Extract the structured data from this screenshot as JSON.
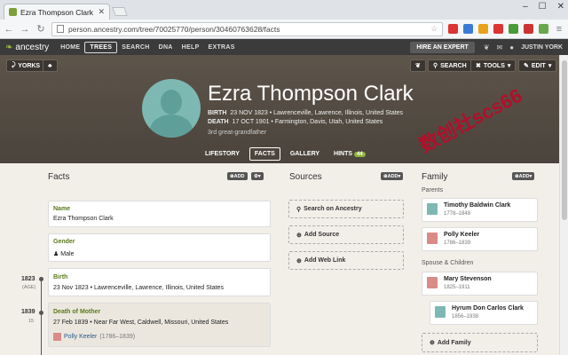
{
  "browser": {
    "tab_title": "Ezra Thompson Clark",
    "url": "person.ancestry.com/tree/70025770/person/30460763628/facts"
  },
  "nav": {
    "logo": "ancestry",
    "links": [
      "HOME",
      "TREES",
      "SEARCH",
      "DNA",
      "HELP",
      "EXTRAS"
    ],
    "active": "TREES",
    "hire": "HIRE AN EXPERT",
    "user": "JUSTIN YORK"
  },
  "toolbar": {
    "tree_label": "YORKS",
    "search": "SEARCH",
    "tools": "TOOLS",
    "edit": "EDIT"
  },
  "person": {
    "name": "Ezra Thompson Clark",
    "birth_label": "BIRTH",
    "birth": "23 NOV 1823 • Lawrenceville, Lawrence, Illinois, United States",
    "death_label": "DEATH",
    "death": "17 OCT 1901 • Farmington, Davis, Utah, United States",
    "relation": "3rd great-grandfather"
  },
  "person_tabs": [
    "LIFESTORY",
    "FACTS",
    "GALLERY",
    "HINTS"
  ],
  "hints_count": "44",
  "watermark": "数创社scs66",
  "facts": {
    "title": "Facts",
    "add": "ADD",
    "items": [
      {
        "label": "Name",
        "value": "Ezra Thompson Clark"
      },
      {
        "label": "Gender",
        "value": "Male"
      },
      {
        "label": "Birth",
        "value": "23 Nov 1823 • Lawrenceville, Lawrence, Illinois, United States",
        "year": "1823",
        "age": "(AGE)"
      },
      {
        "label": "Death of Mother",
        "value": "27 Feb 1839 • Near Far West, Caldwell, Missouri, United States",
        "year": "1839",
        "age": "15",
        "person": "Polly Keeler",
        "person_dates": "(1786–1839)"
      }
    ]
  },
  "sources": {
    "title": "Sources",
    "add": "ADD",
    "actions": [
      "Search on Ancestry",
      "Add Source",
      "Add Web Link"
    ]
  },
  "family": {
    "title": "Family",
    "add": "ADD",
    "parents_label": "Parents",
    "parents": [
      {
        "name": "Timothy Baldwin Clark",
        "dates": "1778–1848",
        "sex": "m"
      },
      {
        "name": "Polly Keeler",
        "dates": "1786–1839",
        "sex": "f"
      }
    ],
    "spouse_label": "Spouse & Children",
    "spouse": {
      "name": "Mary Stevenson",
      "dates": "1825–1911",
      "sex": "f"
    },
    "child": {
      "name": "Hyrum Don Carlos Clark",
      "dates": "1856–1938",
      "sex": "m"
    },
    "add_family": "Add Family"
  }
}
